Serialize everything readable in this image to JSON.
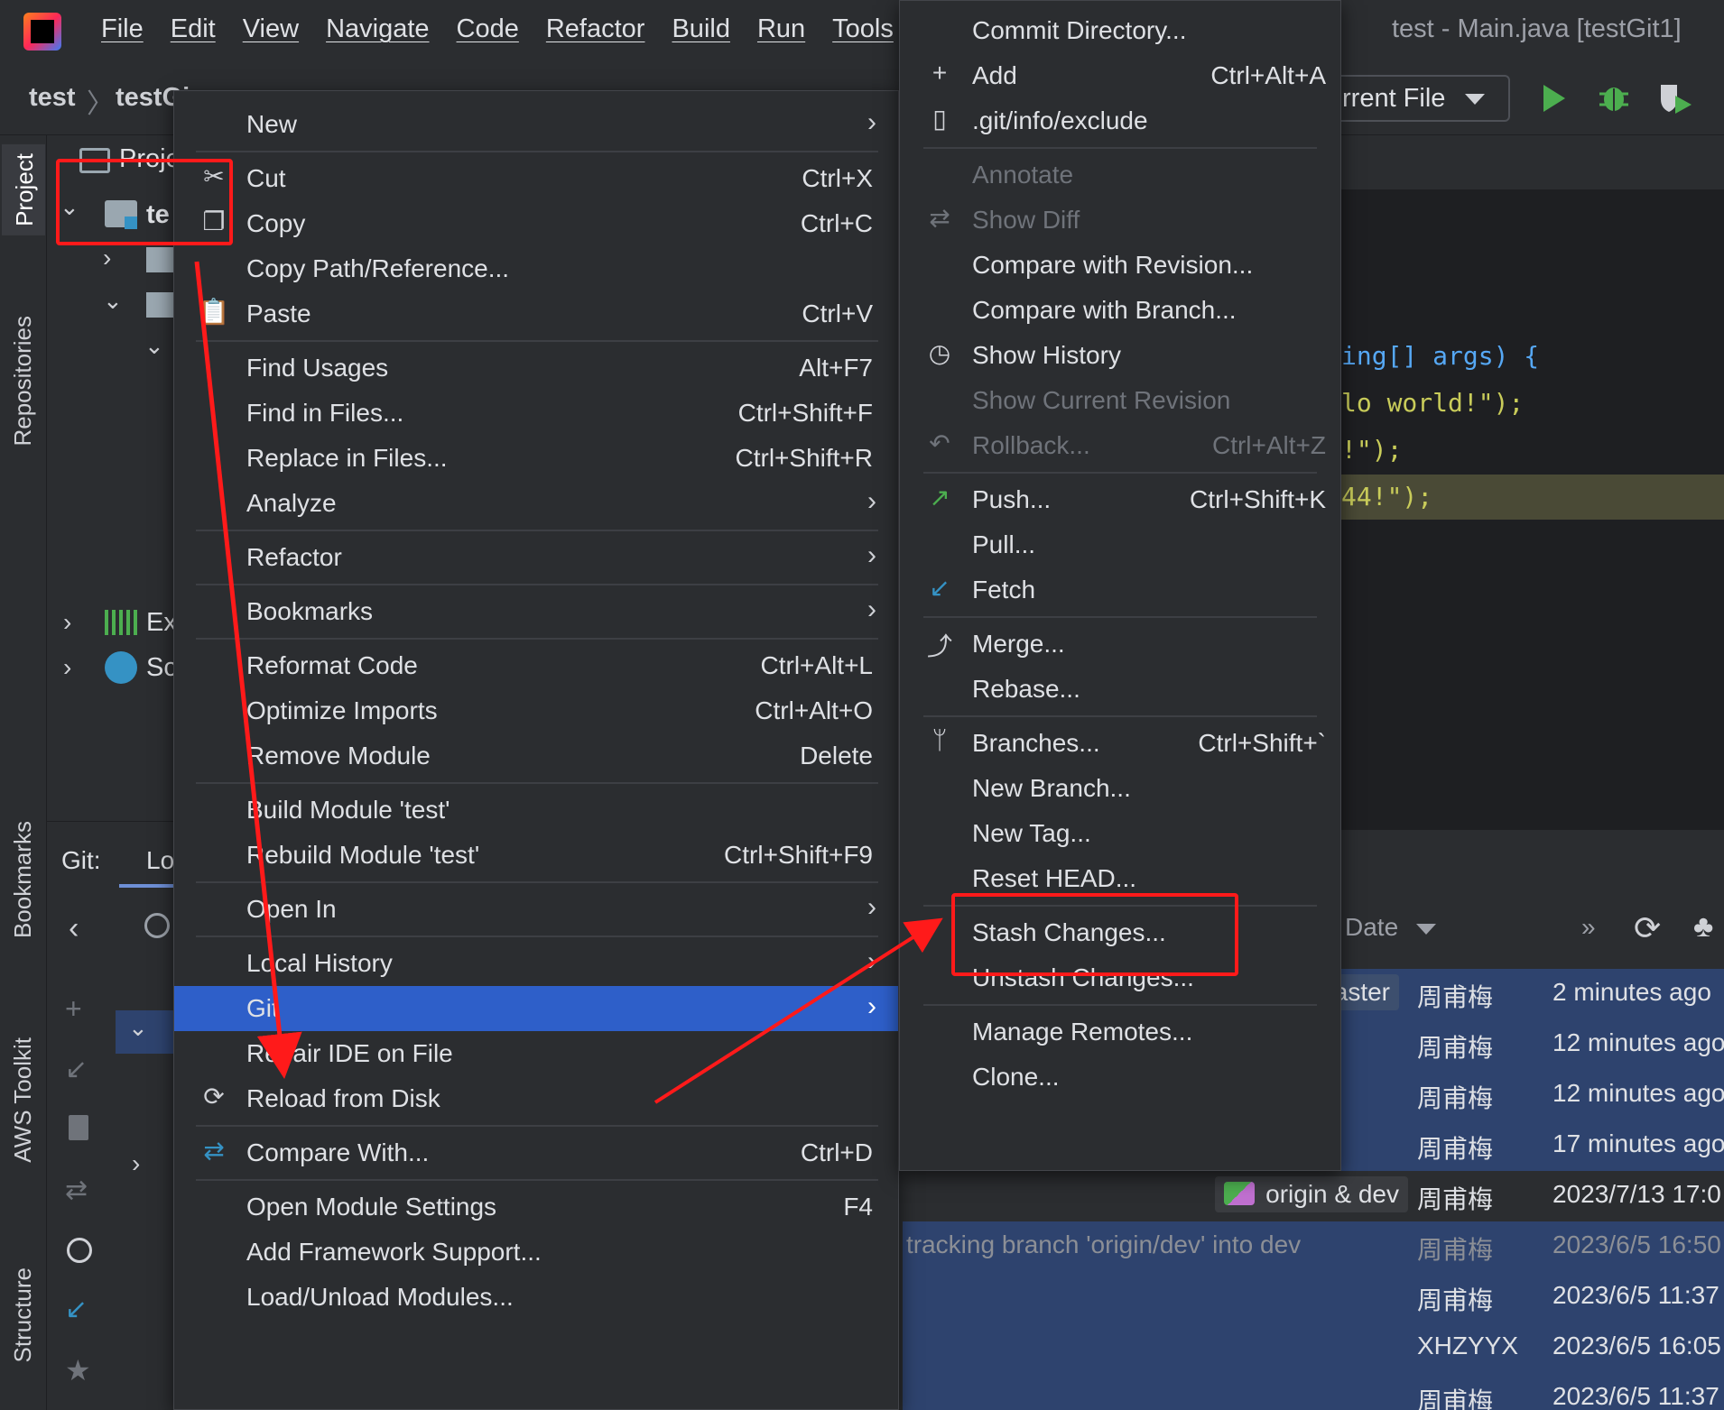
{
  "window": {
    "title": "test - Main.java [testGit1]",
    "menu": [
      "File",
      "Edit",
      "View",
      "Navigate",
      "Code",
      "Refactor",
      "Build",
      "Run",
      "Tools"
    ]
  },
  "navbar": {
    "breadcrumb": [
      "test",
      "testGi"
    ],
    "run_config": "rrent File"
  },
  "tool_windows": {
    "left": [
      "Project",
      "Repositories",
      "Bookmarks",
      "AWS Toolkit",
      "Structure"
    ]
  },
  "project_tree": {
    "header": "Proje",
    "root": "te",
    "external_libs": "Ex",
    "scratches": "Sc"
  },
  "git_panel": {
    "label": "Git:",
    "tab": "Lo"
  },
  "editor": {
    "lines": [
      "ing[] args) {",
      "lo world!\");",
      "!\");",
      "44!\");"
    ]
  },
  "log": {
    "date_header": "Date",
    "rows": [
      {
        "branch": "aster",
        "author": "周甫梅",
        "date": "2 minutes ago",
        "selected": true
      },
      {
        "branch": "",
        "author": "周甫梅",
        "date": "12 minutes ago",
        "selected": true
      },
      {
        "branch": "",
        "author": "周甫梅",
        "date": "12 minutes ago",
        "selected": true
      },
      {
        "branch": "",
        "author": "周甫梅",
        "date": "17 minutes ago",
        "selected": true
      },
      {
        "branch": "origin & dev",
        "author": "周甫梅",
        "date": "2023/7/13 17:0",
        "selected": false
      },
      {
        "branch": "",
        "author": "周甫梅",
        "date": "2023/6/5 16:50",
        "selected": true,
        "message": "tracking branch 'origin/dev' into dev"
      },
      {
        "branch": "",
        "author": "周甫梅",
        "date": "2023/6/5 11:37",
        "selected": true
      },
      {
        "branch": "",
        "author": "XHZYYX",
        "date": "2023/6/5 16:05",
        "selected": true
      },
      {
        "branch": "",
        "author": "周甫梅",
        "date": "2023/6/5 11:37",
        "selected": true
      }
    ]
  },
  "context_menu": {
    "items": [
      {
        "label": "New",
        "shortcut": "",
        "submenu": true
      },
      {
        "sep": true
      },
      {
        "label": "Cut",
        "shortcut": "Ctrl+X",
        "icon": "scissors-icon"
      },
      {
        "label": "Copy",
        "shortcut": "Ctrl+C",
        "icon": "copy-icon"
      },
      {
        "label": "Copy Path/Reference...",
        "shortcut": ""
      },
      {
        "label": "Paste",
        "shortcut": "Ctrl+V",
        "icon": "clipboard-icon"
      },
      {
        "sep": true
      },
      {
        "label": "Find Usages",
        "shortcut": "Alt+F7"
      },
      {
        "label": "Find in Files...",
        "shortcut": "Ctrl+Shift+F"
      },
      {
        "label": "Replace in Files...",
        "shortcut": "Ctrl+Shift+R"
      },
      {
        "label": "Analyze",
        "shortcut": "",
        "submenu": true
      },
      {
        "sep": true
      },
      {
        "label": "Refactor",
        "shortcut": "",
        "submenu": true
      },
      {
        "sep": true
      },
      {
        "label": "Bookmarks",
        "shortcut": "",
        "submenu": true
      },
      {
        "sep": true
      },
      {
        "label": "Reformat Code",
        "shortcut": "Ctrl+Alt+L"
      },
      {
        "label": "Optimize Imports",
        "shortcut": "Ctrl+Alt+O"
      },
      {
        "label": "Remove Module",
        "shortcut": "Delete"
      },
      {
        "sep": true
      },
      {
        "label": "Build Module 'test'",
        "shortcut": ""
      },
      {
        "label": "Rebuild Module 'test'",
        "shortcut": "Ctrl+Shift+F9"
      },
      {
        "sep": true
      },
      {
        "label": "Open In",
        "shortcut": "",
        "submenu": true
      },
      {
        "sep": true
      },
      {
        "label": "Local History",
        "shortcut": "",
        "submenu": true
      },
      {
        "label": "Git",
        "shortcut": "",
        "submenu": true,
        "active": true
      },
      {
        "label": "Repair IDE on File",
        "shortcut": ""
      },
      {
        "label": "Reload from Disk",
        "shortcut": "",
        "icon": "reload-icon"
      },
      {
        "sep": true
      },
      {
        "label": "Compare With...",
        "shortcut": "Ctrl+D",
        "icon": "compare-icon"
      },
      {
        "sep": true
      },
      {
        "label": "Open Module Settings",
        "shortcut": "F4"
      },
      {
        "label": "Add Framework Support...",
        "shortcut": ""
      },
      {
        "label": "Load/Unload Modules...",
        "shortcut": ""
      }
    ]
  },
  "git_submenu": {
    "items": [
      {
        "label": "Commit Directory...",
        "shortcut": ""
      },
      {
        "label": "Add",
        "shortcut": "Ctrl+Alt+A",
        "icon": "plus-icon"
      },
      {
        "label": ".git/info/exclude",
        "shortcut": "",
        "icon": "file-exclude-icon"
      },
      {
        "sep": true
      },
      {
        "label": "Annotate",
        "shortcut": "",
        "disabled": true
      },
      {
        "label": "Show Diff",
        "shortcut": "",
        "disabled": true,
        "icon": "diff-icon"
      },
      {
        "label": "Compare with Revision...",
        "shortcut": ""
      },
      {
        "label": "Compare with Branch...",
        "shortcut": ""
      },
      {
        "label": "Show History",
        "shortcut": "",
        "icon": "clock-icon"
      },
      {
        "label": "Show Current Revision",
        "shortcut": "",
        "disabled": true
      },
      {
        "label": "Rollback...",
        "shortcut": "Ctrl+Alt+Z",
        "disabled": true,
        "icon": "rollback-icon"
      },
      {
        "sep": true
      },
      {
        "label": "Push...",
        "shortcut": "Ctrl+Shift+K",
        "icon": "push-icon"
      },
      {
        "label": "Pull...",
        "shortcut": ""
      },
      {
        "label": "Fetch",
        "shortcut": "",
        "icon": "fetch-icon"
      },
      {
        "sep": true
      },
      {
        "label": "Merge...",
        "shortcut": "",
        "icon": "merge-icon"
      },
      {
        "label": "Rebase...",
        "shortcut": ""
      },
      {
        "sep": true
      },
      {
        "label": "Branches...",
        "shortcut": "Ctrl+Shift+`",
        "icon": "branch-icon"
      },
      {
        "label": "New Branch...",
        "shortcut": ""
      },
      {
        "label": "New Tag...",
        "shortcut": ""
      },
      {
        "label": "Reset HEAD...",
        "shortcut": ""
      },
      {
        "sep": true
      },
      {
        "label": "Stash Changes...",
        "shortcut": ""
      },
      {
        "label": "Unstash Changes...",
        "shortcut": ""
      },
      {
        "sep": true
      },
      {
        "label": "Manage Remotes...",
        "shortcut": ""
      },
      {
        "label": "Clone...",
        "shortcut": ""
      }
    ]
  },
  "colors": {
    "background": "#2b2d30",
    "editor_bg": "#1e1f22",
    "active_item": "#2e5fc9",
    "annotation_red": "#ff1a1a",
    "selected_row": "#2e436e"
  }
}
